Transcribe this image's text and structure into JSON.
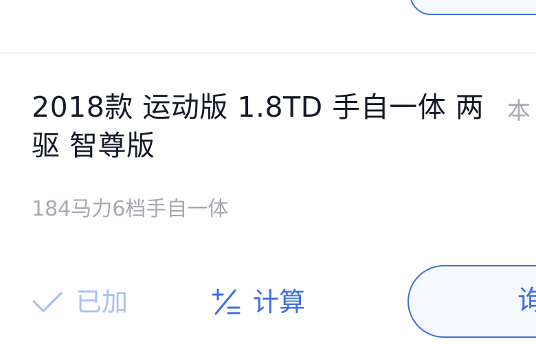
{
  "card": {
    "title": "2018款 运动版 1.8TD 手自一体 两驱 智尊版",
    "side_label": "本",
    "subtitle": "184马力6档手自一体"
  },
  "actions": {
    "added_label": "已加",
    "calc_label": "计算",
    "inquiry_label": "询"
  },
  "icons": {
    "added": "check-icon",
    "calc": "plus-minus-icon"
  },
  "colors": {
    "accent": "#3d6de0",
    "added_disabled": "#a9c0f0",
    "title": "#151a28",
    "muted": "#a4a8b3"
  }
}
